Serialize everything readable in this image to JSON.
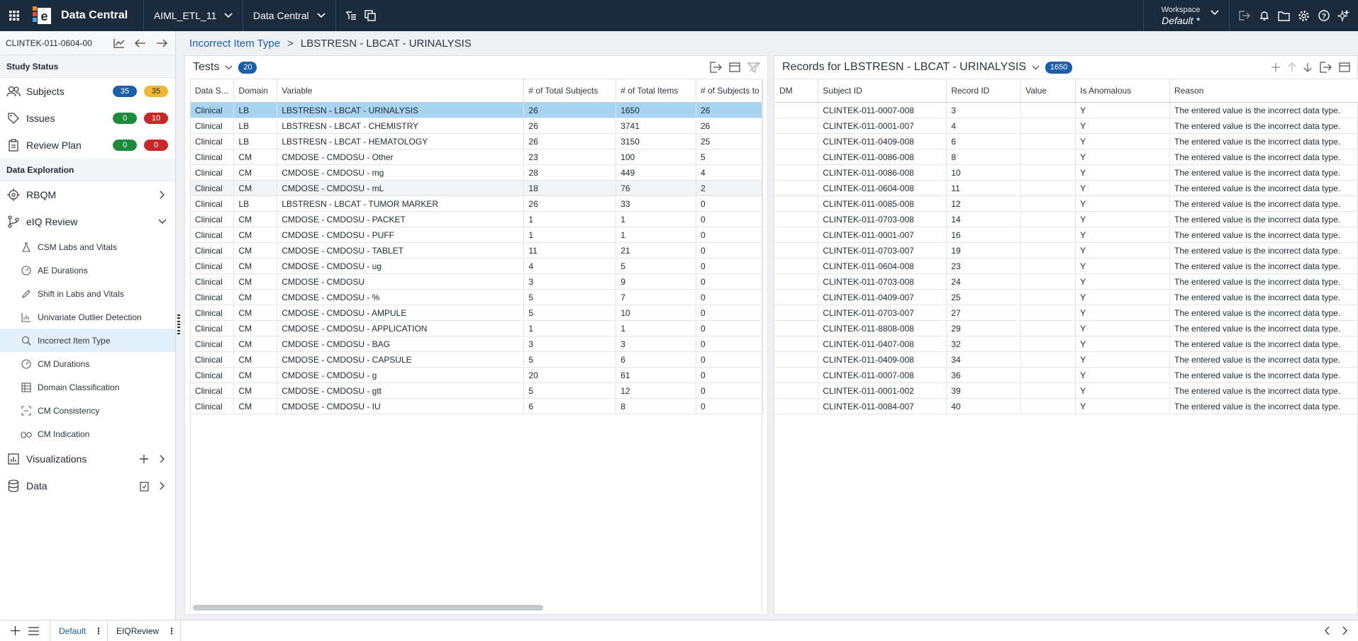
{
  "topbar": {
    "app_name": "Data Central",
    "study_select": "AIML_ETL_11",
    "app_select": "Data Central",
    "workspace_label": "Workspace",
    "workspace_value": "Default",
    "workspace_modified": "*"
  },
  "sidebar": {
    "study_id": "CLINTEK-011-0604-00",
    "study_status_title": "Study Status",
    "status_rows": [
      {
        "label": "Subjects",
        "badge1": "35",
        "badge2": "35"
      },
      {
        "label": "Issues",
        "badge1": "0",
        "badge2": "10"
      },
      {
        "label": "Review Plan",
        "badge1": "0",
        "badge2": "0"
      }
    ],
    "data_exploration_title": "Data Exploration",
    "rbqm_label": "RBQM",
    "eiq_label": "eIQ Review",
    "sub_items": [
      "CSM Labs and Vitals",
      "AE Durations",
      "Shift in Labs and Vitals",
      "Univariate Outlier Detection",
      "Incorrect Item Type",
      "CM Durations",
      "Domain Classification",
      "CM Consistency",
      "CM Indication"
    ],
    "visualizations_label": "Visualizations",
    "data_label": "Data"
  },
  "breadcrumb": {
    "parent": "Incorrect Item Type",
    "separator": ">",
    "current": "LBSTRESN - LBCAT - URINALYSIS"
  },
  "tests_panel": {
    "title": "Tests",
    "count": "20",
    "columns": [
      "Data S...",
      "Domain",
      "Variable",
      "# of Total Subjects",
      "# of Total Items",
      "# of Subjects to"
    ],
    "rows": [
      [
        "Clinical",
        "LB",
        "LBSTRESN - LBCAT - URINALYSIS",
        "26",
        "1650",
        "26"
      ],
      [
        "Clinical",
        "LB",
        "LBSTRESN - LBCAT - CHEMISTRY",
        "26",
        "3741",
        "26"
      ],
      [
        "Clinical",
        "LB",
        "LBSTRESN - LBCAT - HEMATOLOGY",
        "26",
        "3150",
        "25"
      ],
      [
        "Clinical",
        "CM",
        "CMDOSE - CMDOSU - Other",
        "23",
        "100",
        "5"
      ],
      [
        "Clinical",
        "CM",
        "CMDOSE - CMDOSU - mg",
        "28",
        "449",
        "4"
      ],
      [
        "Clinical",
        "CM",
        "CMDOSE - CMDOSU - mL",
        "18",
        "76",
        "2"
      ],
      [
        "Clinical",
        "LB",
        "LBSTRESN - LBCAT - TUMOR MARKER",
        "26",
        "33",
        "0"
      ],
      [
        "Clinical",
        "CM",
        "CMDOSE - CMDOSU - PACKET",
        "1",
        "1",
        "0"
      ],
      [
        "Clinical",
        "CM",
        "CMDOSE - CMDOSU - PUFF",
        "1",
        "1",
        "0"
      ],
      [
        "Clinical",
        "CM",
        "CMDOSE - CMDOSU - TABLET",
        "11",
        "21",
        "0"
      ],
      [
        "Clinical",
        "CM",
        "CMDOSE - CMDOSU - ug",
        "4",
        "5",
        "0"
      ],
      [
        "Clinical",
        "CM",
        "CMDOSE - CMDOSU",
        "3",
        "9",
        "0"
      ],
      [
        "Clinical",
        "CM",
        "CMDOSE - CMDOSU - %",
        "5",
        "7",
        "0"
      ],
      [
        "Clinical",
        "CM",
        "CMDOSE - CMDOSU - AMPULE",
        "5",
        "10",
        "0"
      ],
      [
        "Clinical",
        "CM",
        "CMDOSE - CMDOSU - APPLICATION",
        "1",
        "1",
        "0"
      ],
      [
        "Clinical",
        "CM",
        "CMDOSE - CMDOSU - BAG",
        "3",
        "3",
        "0"
      ],
      [
        "Clinical",
        "CM",
        "CMDOSE - CMDOSU - CAPSULE",
        "5",
        "6",
        "0"
      ],
      [
        "Clinical",
        "CM",
        "CMDOSE - CMDOSU - g",
        "20",
        "61",
        "0"
      ],
      [
        "Clinical",
        "CM",
        "CMDOSE - CMDOSU - gtt",
        "5",
        "12",
        "0"
      ],
      [
        "Clinical",
        "CM",
        "CMDOSE - CMDOSU - IU",
        "6",
        "8",
        "0"
      ]
    ]
  },
  "records_panel": {
    "title": "Records for LBSTRESN - LBCAT - URINALYSIS",
    "count": "1650",
    "columns": [
      "DM",
      "Subject ID",
      "Record ID",
      "Value",
      "Is Anomalous",
      "Reason"
    ],
    "rows": [
      [
        "",
        "CLINTEK-011-0007-008",
        "3",
        "",
        "Y",
        "The entered value is the incorrect data type."
      ],
      [
        "",
        "CLINTEK-011-0001-007",
        "4",
        "",
        "Y",
        "The entered value is the incorrect data type."
      ],
      [
        "",
        "CLINTEK-011-0409-008",
        "6",
        "",
        "Y",
        "The entered value is the incorrect data type."
      ],
      [
        "",
        "CLINTEK-011-0086-008",
        "8",
        "",
        "Y",
        "The entered value is the incorrect data type."
      ],
      [
        "",
        "CLINTEK-011-0086-008",
        "10",
        "",
        "Y",
        "The entered value is the incorrect data type."
      ],
      [
        "",
        "CLINTEK-011-0604-008",
        "11",
        "",
        "Y",
        "The entered value is the incorrect data type."
      ],
      [
        "",
        "CLINTEK-011-0085-008",
        "12",
        "",
        "Y",
        "The entered value is the incorrect data type."
      ],
      [
        "",
        "CLINTEK-011-0703-008",
        "14",
        "",
        "Y",
        "The entered value is the incorrect data type."
      ],
      [
        "",
        "CLINTEK-011-0001-007",
        "16",
        "",
        "Y",
        "The entered value is the incorrect data type."
      ],
      [
        "",
        "CLINTEK-011-0703-007",
        "19",
        "",
        "Y",
        "The entered value is the incorrect data type."
      ],
      [
        "",
        "CLINTEK-011-0604-008",
        "23",
        "",
        "Y",
        "The entered value is the incorrect data type."
      ],
      [
        "",
        "CLINTEK-011-0703-008",
        "24",
        "",
        "Y",
        "The entered value is the incorrect data type."
      ],
      [
        "",
        "CLINTEK-011-0409-007",
        "25",
        "",
        "Y",
        "The entered value is the incorrect data type."
      ],
      [
        "",
        "CLINTEK-011-0703-007",
        "27",
        "",
        "Y",
        "The entered value is the incorrect data type."
      ],
      [
        "",
        "CLINTEK-011-8808-008",
        "29",
        "",
        "Y",
        "The entered value is the incorrect data type."
      ],
      [
        "",
        "CLINTEK-011-0407-008",
        "32",
        "",
        "Y",
        "The entered value is the incorrect data type."
      ],
      [
        "",
        "CLINTEK-011-0409-008",
        "34",
        "",
        "Y",
        "The entered value is the incorrect data type."
      ],
      [
        "",
        "CLINTEK-011-0007-008",
        "36",
        "",
        "Y",
        "The entered value is the incorrect data type."
      ],
      [
        "",
        "CLINTEK-011-0001-002",
        "39",
        "",
        "Y",
        "The entered value is the incorrect data type."
      ],
      [
        "",
        "CLINTEK-011-0084-007",
        "40",
        "",
        "Y",
        "The entered value is the incorrect data type."
      ]
    ]
  },
  "bottombar": {
    "tabs": [
      "Default",
      "EIQReview"
    ]
  },
  "colors": {
    "topbar_bg": "#1c2b3c",
    "accent": "#1a5fa8",
    "selected_row": "#a8d4f2",
    "badge_yellow": "#f2b731",
    "badge_green": "#1e8a3b",
    "badge_red": "#c62828"
  },
  "icons": [
    "apps-grid-icon",
    "app-logo-icon",
    "chevron-down-icon",
    "filter-tree-icon",
    "copy-icon",
    "export-icon",
    "bell-icon",
    "folder-icon",
    "gear-icon",
    "help-icon",
    "sparkle-icon",
    "trend-icon",
    "back-icon",
    "forward-icon",
    "people-icon",
    "tag-icon",
    "clipboard-icon",
    "target-icon",
    "branch-icon",
    "chevron-right-icon",
    "flask-icon",
    "gauge-icon",
    "pencil-icon",
    "chart-icon",
    "search-doc-icon",
    "table-icon",
    "scan-icon",
    "pills-icon",
    "bar-chart-icon",
    "database-icon",
    "plus-icon",
    "menu-icon",
    "kebab-icon",
    "chevron-left-icon",
    "columns-icon",
    "funnel-icon",
    "arrow-up-icon",
    "arrow-down-icon"
  ]
}
